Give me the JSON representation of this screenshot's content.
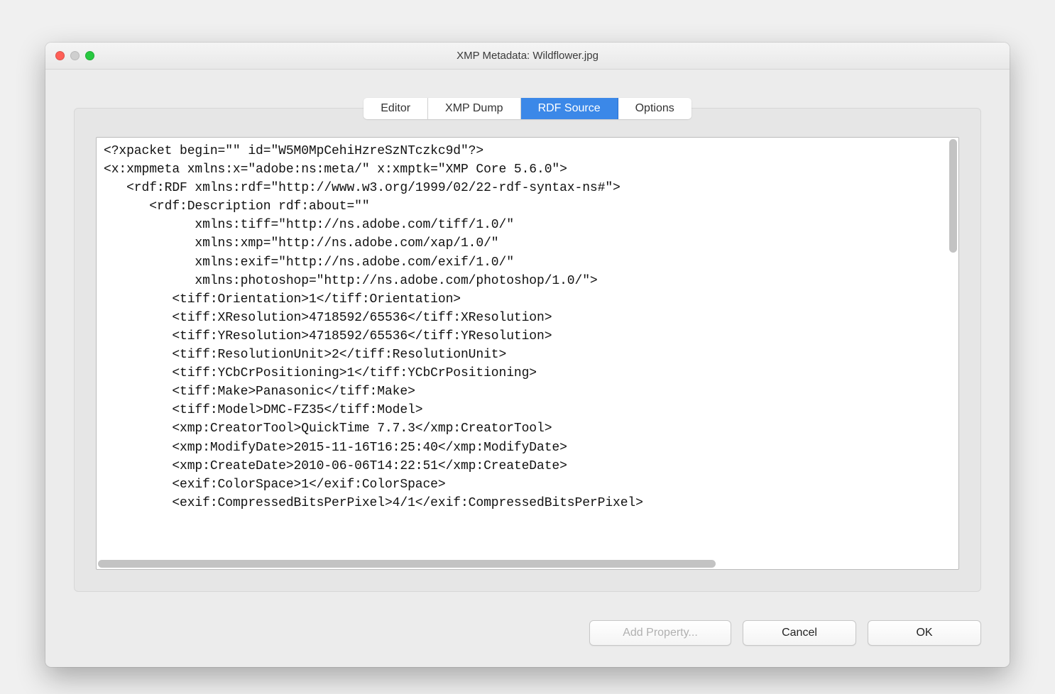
{
  "window": {
    "title": "XMP Metadata: Wildflower.jpg"
  },
  "tabs": {
    "editor": "Editor",
    "xmp_dump": "XMP Dump",
    "rdf_source": "RDF Source",
    "options": "Options",
    "active": "rdf_source"
  },
  "source": {
    "text": "<?xpacket begin=\"\" id=\"W5M0MpCehiHzreSzNTczkc9d\"?>\n<x:xmpmeta xmlns:x=\"adobe:ns:meta/\" x:xmptk=\"XMP Core 5.6.0\">\n   <rdf:RDF xmlns:rdf=\"http://www.w3.org/1999/02/22-rdf-syntax-ns#\">\n      <rdf:Description rdf:about=\"\"\n            xmlns:tiff=\"http://ns.adobe.com/tiff/1.0/\"\n            xmlns:xmp=\"http://ns.adobe.com/xap/1.0/\"\n            xmlns:exif=\"http://ns.adobe.com/exif/1.0/\"\n            xmlns:photoshop=\"http://ns.adobe.com/photoshop/1.0/\">\n         <tiff:Orientation>1</tiff:Orientation>\n         <tiff:XResolution>4718592/65536</tiff:XResolution>\n         <tiff:YResolution>4718592/65536</tiff:YResolution>\n         <tiff:ResolutionUnit>2</tiff:ResolutionUnit>\n         <tiff:YCbCrPositioning>1</tiff:YCbCrPositioning>\n         <tiff:Make>Panasonic</tiff:Make>\n         <tiff:Model>DMC-FZ35</tiff:Model>\n         <xmp:CreatorTool>QuickTime 7.7.3</xmp:CreatorTool>\n         <xmp:ModifyDate>2015-11-16T16:25:40</xmp:ModifyDate>\n         <xmp:CreateDate>2010-06-06T14:22:51</xmp:CreateDate>\n         <exif:ColorSpace>1</exif:ColorSpace>\n         <exif:CompressedBitsPerPixel>4/1</exif:CompressedBitsPerPixel>"
  },
  "buttons": {
    "add_property": "Add Property...",
    "cancel": "Cancel",
    "ok": "OK"
  }
}
